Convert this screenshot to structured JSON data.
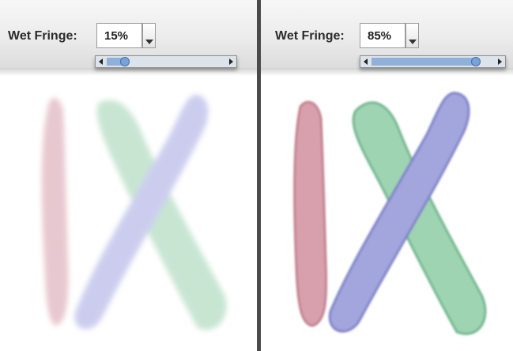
{
  "left_panel": {
    "wet_fringe_label": "Wet Fringe:",
    "wet_fringe_value": "15%",
    "slider_fraction": 0.15
  },
  "right_panel": {
    "wet_fringe_label": "Wet Fringe:",
    "wet_fringe_value": "85%",
    "slider_fraction": 0.85
  },
  "colors": {
    "red_stroke": "#d9a6b0",
    "green_stroke": "#9fd2b0",
    "blue_stroke": "#a9abe0"
  },
  "icons": [
    "chevron-down-icon",
    "arrow-left-icon",
    "arrow-right-icon",
    "slider-thumb-icon"
  ]
}
